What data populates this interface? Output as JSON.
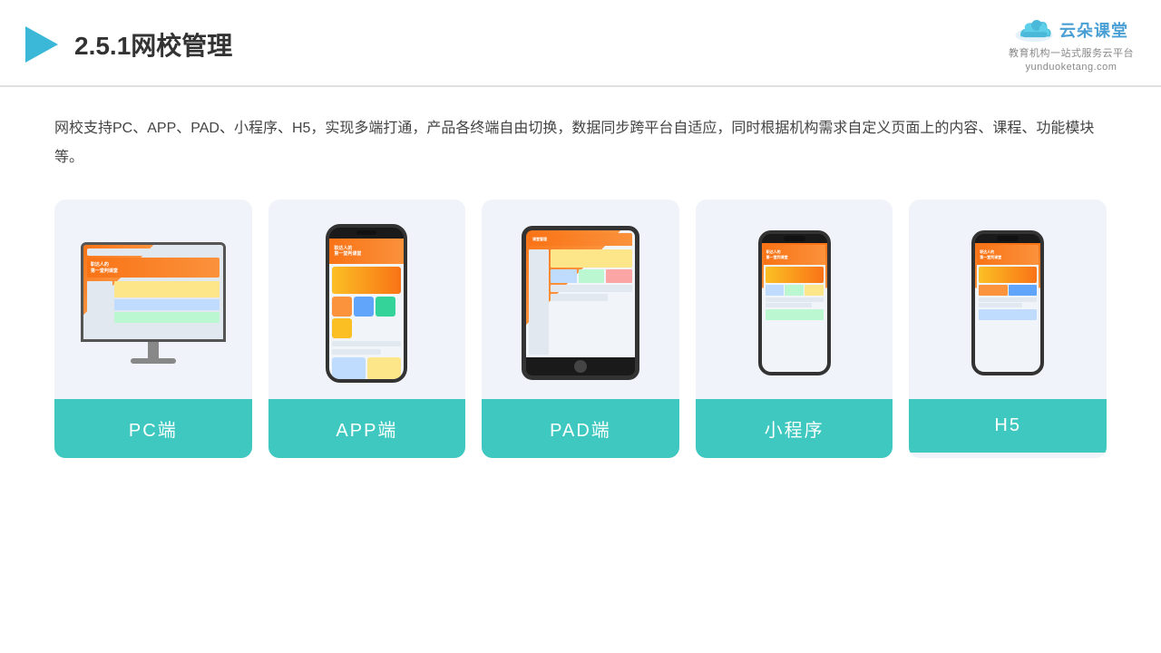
{
  "header": {
    "title": "2.5.1网校管理",
    "logo_main": "云朵课堂",
    "logo_domain": "yunduoketang.com",
    "logo_slogan": "教育机构一站式服务云平台"
  },
  "description": {
    "text": "网校支持PC、APP、PAD、小程序、H5，实现多端打通，产品各终端自由切换，数据同步跨平台自适应，同时根据机构需求自定义页面上的内容、课程、功能模块等。"
  },
  "cards": [
    {
      "label": "PC端"
    },
    {
      "label": "APP端"
    },
    {
      "label": "PAD端"
    },
    {
      "label": "小程序"
    },
    {
      "label": "H5"
    }
  ]
}
